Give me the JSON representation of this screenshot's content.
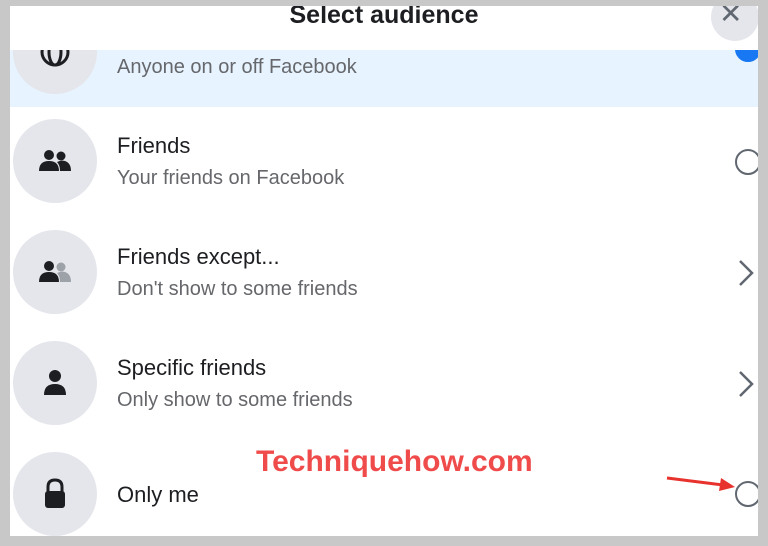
{
  "dialog": {
    "title": "Select audience",
    "close_glyph": "✕"
  },
  "options": [
    {
      "title": "",
      "subtitle": "Anyone on or off Facebook",
      "icon": "globe-icon",
      "control": "radio-selected"
    },
    {
      "title": "Friends",
      "subtitle": "Your friends on Facebook",
      "icon": "friends-icon",
      "control": "radio"
    },
    {
      "title": "Friends except...",
      "subtitle": "Don't show to some friends",
      "icon": "friends-except-icon",
      "control": "chevron"
    },
    {
      "title": "Specific friends",
      "subtitle": "Only show to some friends",
      "icon": "person-icon",
      "control": "chevron"
    },
    {
      "title": "Only me",
      "subtitle": "",
      "icon": "lock-icon",
      "control": "radio"
    }
  ],
  "watermark": "Techniquehow.com",
  "colors": {
    "selected_row": "#e7f3ff",
    "accent": "#1877f2",
    "annotation": "#f04b4b",
    "icon_bg": "#e4e6eb"
  }
}
